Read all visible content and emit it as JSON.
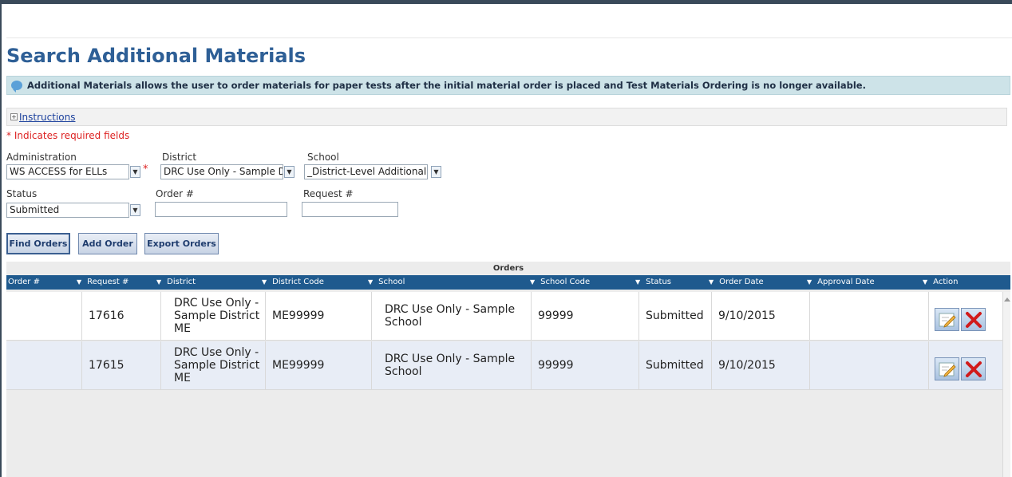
{
  "page": {
    "title": "Search Additional Materials",
    "info_text": "Additional Materials allows the user to order materials for paper tests after the initial material order is placed and Test Materials Ordering is no longer available.",
    "instructions_label": "Instructions",
    "required_note": "* Indicates required fields"
  },
  "filters": {
    "administration": {
      "label": "Administration",
      "value": "WS ACCESS for ELLs"
    },
    "district": {
      "label": "District",
      "value": "DRC Use Only - Sample D"
    },
    "school": {
      "label": "School",
      "value": "_District-Level Additional"
    },
    "status": {
      "label": "Status",
      "value": "Submitted"
    },
    "order_no": {
      "label": "Order #",
      "value": ""
    },
    "request_no": {
      "label": "Request #",
      "value": ""
    }
  },
  "buttons": {
    "find": "Find Orders",
    "add": "Add Order",
    "export": "Export Orders"
  },
  "grid": {
    "caption": "Orders",
    "columns": [
      "Order #",
      "Request #",
      "District",
      "District Code",
      "School",
      "School Code",
      "Status",
      "Order Date",
      "Approval Date",
      "Action"
    ],
    "rows": [
      {
        "order": "",
        "request": "17616",
        "district_l1": "DRC Use Only -",
        "district_l2": "Sample District",
        "district_l3": "ME",
        "district_code": "ME99999",
        "school_l1": "DRC Use Only - Sample",
        "school_l2": "School",
        "school_code": "99999",
        "status": "Submitted",
        "order_date": "9/10/2015",
        "approval_date": ""
      },
      {
        "order": "",
        "request": "17615",
        "district_l1": "DRC Use Only -",
        "district_l2": "Sample District",
        "district_l3": "ME",
        "district_code": "ME99999",
        "school_l1": "DRC Use Only - Sample",
        "school_l2": "School",
        "school_code": "99999",
        "status": "Submitted",
        "order_date": "9/10/2015",
        "approval_date": ""
      }
    ]
  },
  "icons": {
    "info": "speech-bubble-icon",
    "edit": "edit-icon",
    "delete": "delete-icon",
    "dropdown": "chevron-down-icon"
  },
  "colors": {
    "title": "#2e5f96",
    "grid_header": "#1f5a8e",
    "required": "#dd2222",
    "info_bar": "#cde3e8"
  }
}
